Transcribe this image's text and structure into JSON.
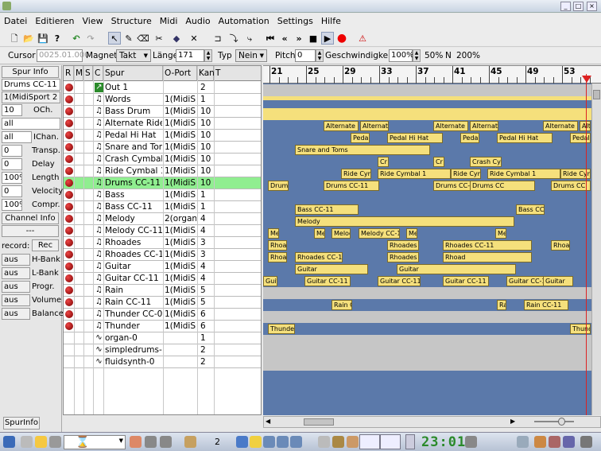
{
  "menubar": [
    "Datei",
    "Editieren",
    "View",
    "Structure",
    "Midi",
    "Audio",
    "Automation",
    "Settings",
    "Hilfe"
  ],
  "position_bar": {
    "cursor_label": "Cursor",
    "cursor_value": "0025.01.000",
    "magnet_label": "Magnet",
    "magnet_value": "Takt",
    "length_label": "Länge",
    "length_value": "171",
    "type_label": "Typ",
    "type_value": "Nein",
    "pitch_label": "Pitch",
    "pitch_value": "0",
    "speed_label": "Geschwindigkeit",
    "speed_value": "100%",
    "speed_opt1": "50%",
    "speed_opt2": "N",
    "speed_opt3": "200%"
  },
  "left_panel": {
    "tab": "Spur Info",
    "track_name": "Drums CC-11",
    "port": "1(MidiSport 2",
    "channel_value": "10",
    "channel_label": "OCh.",
    "all1": "all",
    "all2": "all",
    "ichan_label": "IChan.",
    "transp_value": "0",
    "transp_label": "Transp.",
    "delay_value": "0",
    "delay_label": "Delay",
    "length_value": "100%",
    "length_label": "Length",
    "velocity_value": "0",
    "velocity_label": "Velocity",
    "compr_value": "100%",
    "compr_label": "Compr.",
    "channel_info": "Channel Info",
    "dashes": "---",
    "record_label": "record:",
    "rec_button": "Rec",
    "hbank_value": "aus",
    "hbank_label": "H-Bank",
    "lbank_value": "aus",
    "lbank_label": "L-Bank",
    "progr_value": "aus",
    "progr_label": "Progr.",
    "volume_value": "aus",
    "volume_label": "Volume",
    "balance_value": "aus",
    "balance_label": "Balance",
    "bottom_tab": "SpurInfo"
  },
  "track_headers": [
    "R",
    "M",
    "S",
    "C",
    "Spur",
    "O-Port",
    "Kan",
    "T"
  ],
  "tracks": [
    {
      "name": "Out 1",
      "port": "",
      "ch": "2",
      "type": "out",
      "rec": true
    },
    {
      "name": "Words",
      "port": "1(MidiSp",
      "ch": "1",
      "type": "midi",
      "rec": true
    },
    {
      "name": "Bass Drum",
      "port": "1(MidiSp",
      "ch": "10",
      "type": "midi",
      "rec": true
    },
    {
      "name": "Alternate Ride",
      "port": "1(MidiSp",
      "ch": "10",
      "type": "midi",
      "rec": true
    },
    {
      "name": "Pedal Hi Hat",
      "port": "1(MidiSp",
      "ch": "10",
      "type": "midi",
      "rec": true
    },
    {
      "name": "Snare and Tom",
      "port": "1(MidiSp",
      "ch": "10",
      "type": "midi",
      "rec": true
    },
    {
      "name": "Crash Cymbal",
      "port": "1(MidiSp",
      "ch": "10",
      "type": "midi",
      "rec": true
    },
    {
      "name": "Ride Cymbal 1",
      "port": "1(MidiSp",
      "ch": "10",
      "type": "midi",
      "rec": true
    },
    {
      "name": "Drums CC-11",
      "port": "1(MidiSp",
      "ch": "10",
      "type": "midi",
      "rec": true,
      "selected": true
    },
    {
      "name": "Bass",
      "port": "1(MidiSp",
      "ch": "1",
      "type": "midi",
      "rec": true
    },
    {
      "name": "Bass CC-11",
      "port": "1(MidiSp",
      "ch": "1",
      "type": "midi",
      "rec": true
    },
    {
      "name": "Melody",
      "port": "2(organ-(",
      "ch": "4",
      "type": "midi",
      "rec": true
    },
    {
      "name": "Melody CC-11",
      "port": "1(MidiSp",
      "ch": "4",
      "type": "midi",
      "rec": true
    },
    {
      "name": "Rhoades",
      "port": "1(MidiSp",
      "ch": "3",
      "type": "midi",
      "rec": true
    },
    {
      "name": "Rhoades CC-11",
      "port": "1(MidiSp",
      "ch": "3",
      "type": "midi",
      "rec": true
    },
    {
      "name": "Guitar",
      "port": "1(MidiSp",
      "ch": "4",
      "type": "midi",
      "rec": true
    },
    {
      "name": "Guitar CC-11",
      "port": "1(MidiSp",
      "ch": "4",
      "type": "midi",
      "rec": true
    },
    {
      "name": "Rain",
      "port": "1(MidiSp",
      "ch": "5",
      "type": "midi",
      "rec": true
    },
    {
      "name": "Rain CC-11",
      "port": "1(MidiSp",
      "ch": "5",
      "type": "midi",
      "rec": true
    },
    {
      "name": "Thunder CC-0,2",
      "port": "1(MidiSp",
      "ch": "6",
      "type": "midi",
      "rec": true
    },
    {
      "name": "Thunder",
      "port": "1(MidiSp",
      "ch": "6",
      "type": "midi",
      "rec": true
    },
    {
      "name": "organ-0",
      "port": "",
      "ch": "1",
      "type": "synth",
      "rec": false
    },
    {
      "name": "simpledrums-0",
      "port": "",
      "ch": "2",
      "type": "synth",
      "rec": false
    },
    {
      "name": "fluidsynth-0",
      "port": "",
      "ch": "2",
      "type": "synth",
      "rec": false
    }
  ],
  "ruler_labels": [
    "21",
    "25",
    "29",
    "33",
    "37",
    "41",
    "45",
    "49",
    "53"
  ],
  "parts": [
    [],
    [],
    [],
    [
      "Alternate",
      "Alternate",
      "Alternate",
      "Alternate",
      "Alternate",
      "Alte"
    ],
    [
      "Pedal",
      "Pedal Hi Hat",
      "Pedal",
      "Pedal Hi Hat",
      "Pedal"
    ],
    [
      "Snare and Toms"
    ],
    [
      "Cr",
      "Cr",
      "Crash Cy"
    ],
    [
      "Ride Cym",
      "Ride Cymbal 1",
      "Ride Cym",
      "Ride Cymbal 1",
      "Ride Cym"
    ],
    [
      "Drums",
      "Drums CC-11",
      "Drums CC-11",
      "Drums CC",
      "Drums CC"
    ],
    [],
    [
      "Bass CC-11",
      "Bass CC"
    ],
    [
      "Melody"
    ],
    [
      "Me",
      "Me",
      "Melod",
      "Melody CC-1",
      "Me",
      "Me"
    ],
    [
      "Rhoad",
      "Rhoades",
      "Rhoades CC-11",
      "Rhoad"
    ],
    [
      "Rhoades CC",
      "Rhoades CC-11",
      "Rhoades CC-11",
      "Rhoad"
    ],
    [
      "Guitar",
      "Guitar"
    ],
    [
      "Guitar",
      "Guitar CC-11",
      "Guitar CC-11",
      "Guitar CC-11",
      "Guitar CC-11",
      "Guitar"
    ],
    [],
    [
      "Rain CC",
      "Ra",
      "Rain CC-11"
    ],
    [],
    [
      "Thunder",
      "Thunder"
    ],
    [],
    [],
    []
  ],
  "taskbar": {
    "desktop_num": "2",
    "clock": "23:01"
  }
}
